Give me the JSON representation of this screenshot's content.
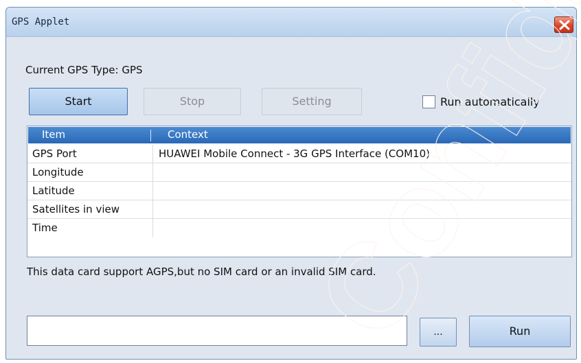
{
  "window": {
    "title": "GPS Applet"
  },
  "header": {
    "gps_type_label": "Current GPS Type: GPS"
  },
  "toolbar": {
    "start_label": "Start",
    "stop_label": "Stop",
    "setting_label": "Setting",
    "run_auto_label": "Run automatically",
    "run_auto_checked": false
  },
  "table": {
    "headers": [
      "Item",
      "Context"
    ],
    "rows": [
      {
        "item": "GPS Port",
        "context": "HUAWEI Mobile Connect - 3G GPS Interface (COM10)"
      },
      {
        "item": "Longitude",
        "context": ""
      },
      {
        "item": "Latitude",
        "context": ""
      },
      {
        "item": "Satellites in view",
        "context": ""
      },
      {
        "item": "Time",
        "context": ""
      }
    ]
  },
  "status": {
    "message": "This data card support AGPS,but no SIM card or an invalid SIM card."
  },
  "command": {
    "input_value": "",
    "browse_label": "...",
    "run_label": "Run"
  },
  "watermark": {
    "text": "Confidential"
  },
  "colors": {
    "title_bar": "#c7dbf1",
    "close_button": "#d9472a",
    "table_header": "#3478c4",
    "window_body": "#dfe6ef"
  }
}
